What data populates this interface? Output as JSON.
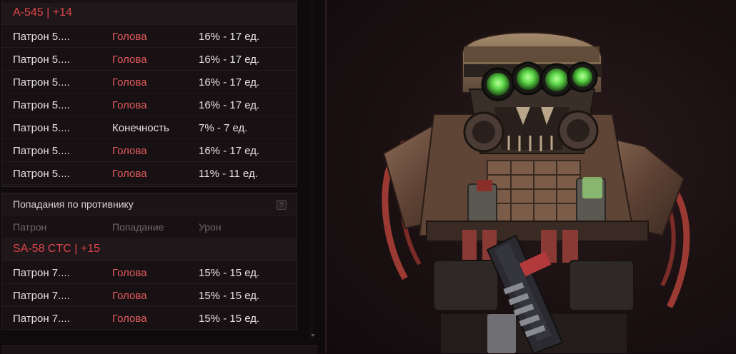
{
  "panel_top": {
    "weapon": "А-545 | +14",
    "rows": [
      {
        "ammo": "Патрон 5....",
        "hit": "Голова",
        "damage": "16% - 17 ед.",
        "critical": true
      },
      {
        "ammo": "Патрон 5....",
        "hit": "Голова",
        "damage": "16% - 17 ед.",
        "critical": true
      },
      {
        "ammo": "Патрон 5....",
        "hit": "Голова",
        "damage": "16% - 17 ед.",
        "critical": true
      },
      {
        "ammo": "Патрон 5....",
        "hit": "Голова",
        "damage": "16% - 17 ед.",
        "critical": true
      },
      {
        "ammo": "Патрон 5....",
        "hit": "Конечность",
        "damage": "7% - 7 ед.",
        "critical": false
      },
      {
        "ammo": "Патрон 5....",
        "hit": "Голова",
        "damage": "16% - 17 ед.",
        "critical": true
      },
      {
        "ammo": "Патрон 5....",
        "hit": "Голова",
        "damage": "11% - 11 ед.",
        "critical": true
      }
    ]
  },
  "panel_bottom": {
    "title": "Попадания по противнику",
    "help_icon_text": "?",
    "columns": [
      "Патрон",
      "Попадание",
      "Урон"
    ],
    "weapon": "SA-58 CTC | +15",
    "rows": [
      {
        "ammo": "Патрон 7....",
        "hit": "Голова",
        "damage": "15% - 15 ед.",
        "critical": true
      },
      {
        "ammo": "Патрон 7....",
        "hit": "Голова",
        "damage": "15% - 15 ед.",
        "critical": true
      },
      {
        "ammo": "Патрон 7....",
        "hit": "Голова",
        "damage": "15% - 15 ед.",
        "critical": true
      }
    ]
  },
  "colors": {
    "critical_hit": "#e25a5e",
    "weapon_name": "#e0454c",
    "normal_text": "#e6e1e2",
    "visor_green": "#5fd94a"
  },
  "icons": {
    "help": "help-icon",
    "model": "armored-soldier-model"
  }
}
